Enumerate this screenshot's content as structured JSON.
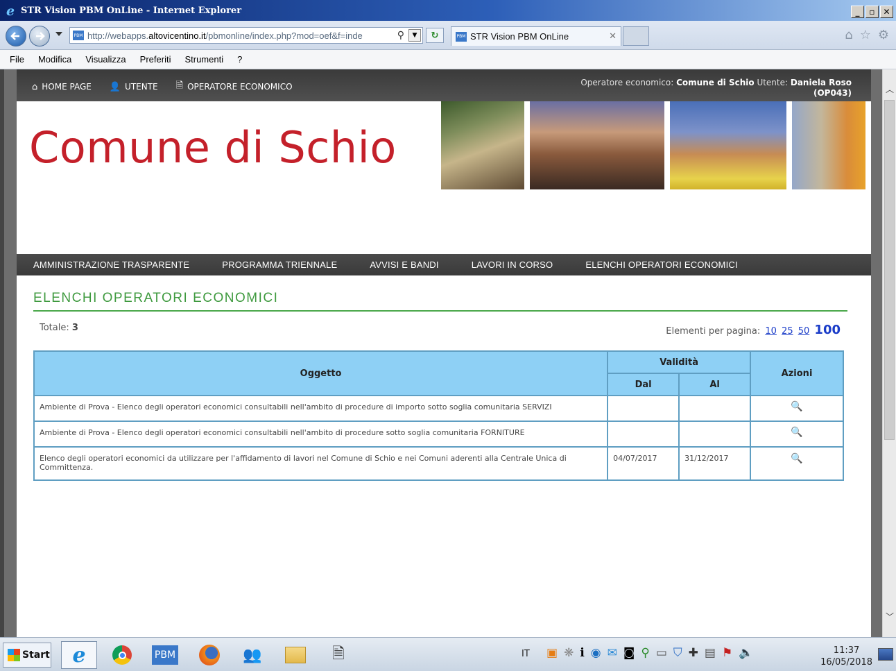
{
  "window": {
    "title": "STR Vision PBM OnLine - Internet Explorer",
    "controls": [
      "_",
      "̅",
      "X"
    ]
  },
  "browser": {
    "url_prefix": "http://webapps.",
    "url_domain": "altovicentino.it",
    "url_path": "/pbmonline/index.php?mod=oef&f=inde",
    "tab_title": "STR Vision PBM OnLine",
    "favicon_text": "PBM",
    "menu": [
      "File",
      "Modifica",
      "Visualizza",
      "Preferiti",
      "Strumenti",
      "?"
    ]
  },
  "topbar": {
    "links": [
      {
        "label": "HOME PAGE",
        "icon": "home-icon"
      },
      {
        "label": "UTENTE",
        "icon": "user-icon"
      },
      {
        "label": "OPERATORE ECONOMICO",
        "icon": "document-icon"
      }
    ],
    "operator_label": "Operatore economico:",
    "operator_name": "Comune di Schio",
    "user_label": "Utente:",
    "user_name": "Daniela Roso",
    "user_code": "(OP043)"
  },
  "header": {
    "site_title": "Comune di Schio"
  },
  "mainnav": [
    "AMMINISTRAZIONE TRASPARENTE",
    "PROGRAMMA TRIENNALE",
    "AVVISI E BANDI",
    "LAVORI IN CORSO",
    "ELENCHI OPERATORI ECONOMICI"
  ],
  "content": {
    "section_title": "ELENCHI OPERATORI ECONOMICI",
    "total_label": "Totale:",
    "total_value": "3",
    "perpage_label": "Elementi per pagina:",
    "perpage_options": [
      "10",
      "25",
      "50"
    ],
    "perpage_current": "100",
    "table": {
      "headers": {
        "oggetto": "Oggetto",
        "validita": "Validità",
        "dal": "Dal",
        "al": "Al",
        "azioni": "Azioni"
      },
      "rows": [
        {
          "oggetto": "Ambiente di Prova - Elenco degli operatori economici consultabili nell'ambito di procedure di importo sotto soglia comunitaria SERVIZI",
          "dal": "",
          "al": ""
        },
        {
          "oggetto": "Ambiente di Prova - Elenco degli operatori economici consultabili nell'ambito di procedure sotto soglia comunitaria FORNITURE",
          "dal": "",
          "al": ""
        },
        {
          "oggetto": "Elenco degli operatori economici da utilizzare per l'affidamento di lavori nel Comune di Schio e nei Comuni aderenti alla Centrale Unica di Committenza.",
          "dal": "04/07/2017",
          "al": "31/12/2017"
        }
      ]
    }
  },
  "taskbar": {
    "start_label": "Start",
    "pbm_label": "PBM",
    "language": "IT",
    "time": "11:37",
    "date": "16/05/2018"
  },
  "colors": {
    "title_red": "#c4202a",
    "section_green": "#3f9a3f",
    "table_header": "#8ed0f5",
    "link_blue": "#1a3cc8"
  }
}
